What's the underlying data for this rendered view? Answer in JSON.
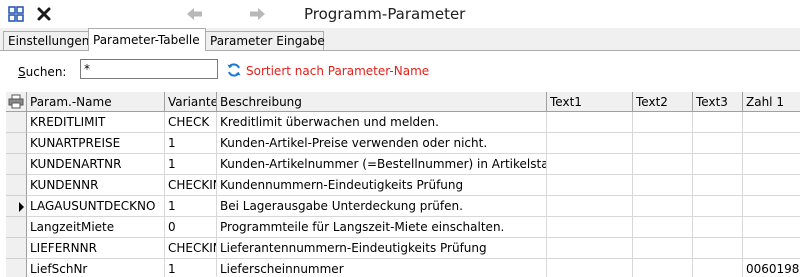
{
  "window": {
    "title": "Programm-Parameter",
    "icons": [
      "grid-icon",
      "close-icon",
      "arrow-left-icon",
      "arrow-right-icon"
    ]
  },
  "tabs": [
    {
      "label": "Einstellungen",
      "active": false
    },
    {
      "label": "Parameter-Tabelle",
      "active": true
    },
    {
      "label": "Parameter Eingabe",
      "active": false
    }
  ],
  "search": {
    "label_prefix": "S",
    "label_rest": "uchen:",
    "value": "*",
    "sort_text": "Sortiert nach Parameter-Name"
  },
  "colors": {
    "sort_text": "#e0201a",
    "header_bg": "#f0f0f0"
  },
  "table": {
    "columns": [
      "Param.-Name",
      "Variante",
      "Beschreibung",
      "Text1",
      "Text2",
      "Text3",
      "Zahl 1"
    ],
    "rows": [
      {
        "name": "KREDITLIMIT",
        "variante": "CHECK",
        "beschreibung": "Kreditlimit überwachen und melden.",
        "text1": "",
        "text2": "",
        "text3": "",
        "zahl1": "",
        "current": false
      },
      {
        "name": "KUNARTPREISE",
        "variante": "1",
        "beschreibung": "Kunden-Artikel-Preise verwenden oder nicht.",
        "text1": "",
        "text2": "",
        "text3": "",
        "zahl1": "",
        "current": false
      },
      {
        "name": "KUNDENARTNR",
        "variante": "1",
        "beschreibung": "Kunden-Artikelnummer (=Bestellnummer) in Artikelstammda",
        "text1": "",
        "text2": "",
        "text3": "",
        "zahl1": "",
        "current": false
      },
      {
        "name": "KUNDENNR",
        "variante": "CHECKIN",
        "beschreibung": "Kundennummern-Eindeutigkeits Prüfung",
        "text1": "",
        "text2": "",
        "text3": "",
        "zahl1": "",
        "current": false
      },
      {
        "name": "LAGAUSUNTDECKNO",
        "variante": "1",
        "beschreibung": "Bei Lagerausgabe Unterdeckung prüfen.",
        "text1": "",
        "text2": "",
        "text3": "",
        "zahl1": "",
        "current": true
      },
      {
        "name": "LangzeitMiete",
        "variante": "0",
        "beschreibung": "Programmteile für Langszeit-Miete einschalten.",
        "text1": "",
        "text2": "",
        "text3": "",
        "zahl1": "",
        "current": false
      },
      {
        "name": "LIEFERNNR",
        "variante": "CHECKIN",
        "beschreibung": "Lieferantennummern-Eindeutigkeits Prüfung",
        "text1": "",
        "text2": "",
        "text3": "",
        "zahl1": "",
        "current": false
      },
      {
        "name": "LiefSchNr",
        "variante": "1",
        "beschreibung": "Lieferscheinnummer",
        "text1": "",
        "text2": "",
        "text3": "",
        "zahl1": "0060198",
        "current": false
      }
    ]
  }
}
